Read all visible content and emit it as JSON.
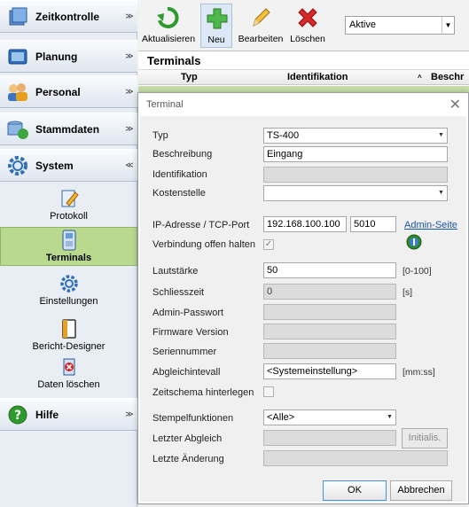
{
  "sidebar": {
    "groups": {
      "zeitkontrolle": "Zeitkontrolle",
      "planung": "Planung",
      "personal": "Personal",
      "stammdaten": "Stammdaten",
      "system": "System",
      "hilfe": "Hilfe"
    },
    "system_items": {
      "protokoll": "Protokoll",
      "terminals": "Terminals",
      "einstellungen": "Einstellungen",
      "bericht_designer": "Bericht-Designer",
      "daten_loeschen": "Daten löschen"
    }
  },
  "toolbar": {
    "aktualisieren": "Aktualisieren",
    "neu": "Neu",
    "bearbeiten": "Bearbeiten",
    "loeschen": "Löschen",
    "filter_value": "Aktive"
  },
  "grid": {
    "title": "Terminals",
    "columns": {
      "typ": "Typ",
      "identifikation": "Identifikation",
      "beschreibung": "Beschr"
    }
  },
  "dialog": {
    "title": "Terminal",
    "labels": {
      "typ": "Typ",
      "beschreibung": "Beschreibung",
      "identifikation": "Identifikation",
      "kostenstelle": "Kostenstelle",
      "ip_port": "IP-Adresse / TCP-Port",
      "verbindung": "Verbindung offen halten",
      "lautstaerke": "Lautstärke",
      "schliesszeit": "Schliesszeit",
      "admin_passwort": "Admin-Passwort",
      "firmware": "Firmware Version",
      "seriennummer": "Seriennummer",
      "abgleichintervall": "Abgleichintevall",
      "zeitschema": "Zeitschema hinterlegen",
      "stempelfunktionen": "Stempelfunktionen",
      "letzter_abgleich": "Letzter Abgleich",
      "letzte_aenderung": "Letzte Änderung"
    },
    "values": {
      "typ": "TS-400",
      "beschreibung": "Eingang",
      "identifikation": "",
      "kostenstelle": "",
      "ip": "192.168.100.100",
      "port": "5010",
      "lautstaerke": "50",
      "schliesszeit": "0",
      "abgleichintervall": "<Systemeinstellung>",
      "stempelfunktionen": "<Alle>"
    },
    "units": {
      "lautstaerke": "[0-100]",
      "schliesszeit": "[s]",
      "abgleich": "[mm:ss]"
    },
    "admin_link": "Admin-Seite",
    "initialis_button": "Initialis.",
    "ok_button": "OK",
    "cancel_button": "Abbrechen"
  }
}
